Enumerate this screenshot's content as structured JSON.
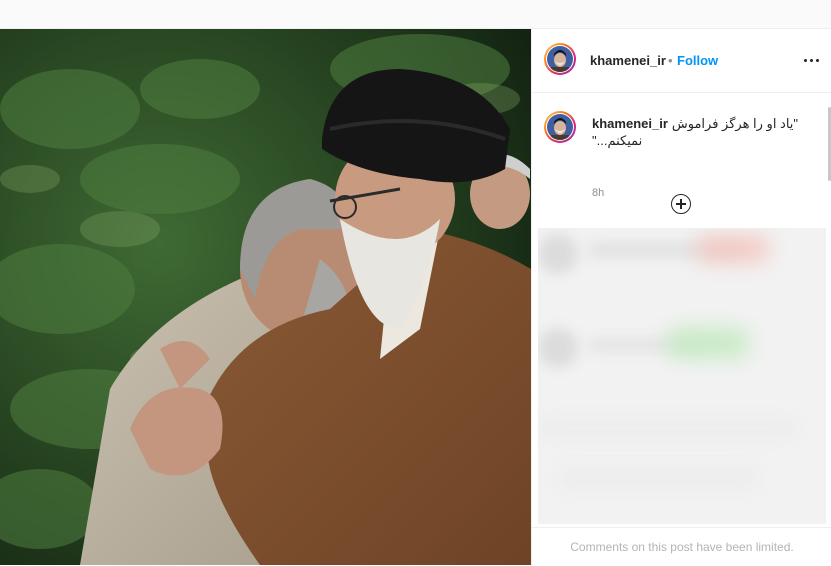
{
  "post": {
    "username": "khamenei_ir",
    "follow_label": "Follow",
    "dot": "•",
    "more_icon": "more-horizontal-icon",
    "caption_user": "khamenei_ir",
    "caption_text": "\"یاد او را هرگز فراموش نمیکنم...\"",
    "time": "8h",
    "add_comment_icon": "plus-circle-icon",
    "comments_limited": "Comments on this post have been limited."
  },
  "colors": {
    "follow": "#0095f6",
    "text": "#262626",
    "muted": "#8e8e8e",
    "border": "#efefef"
  }
}
